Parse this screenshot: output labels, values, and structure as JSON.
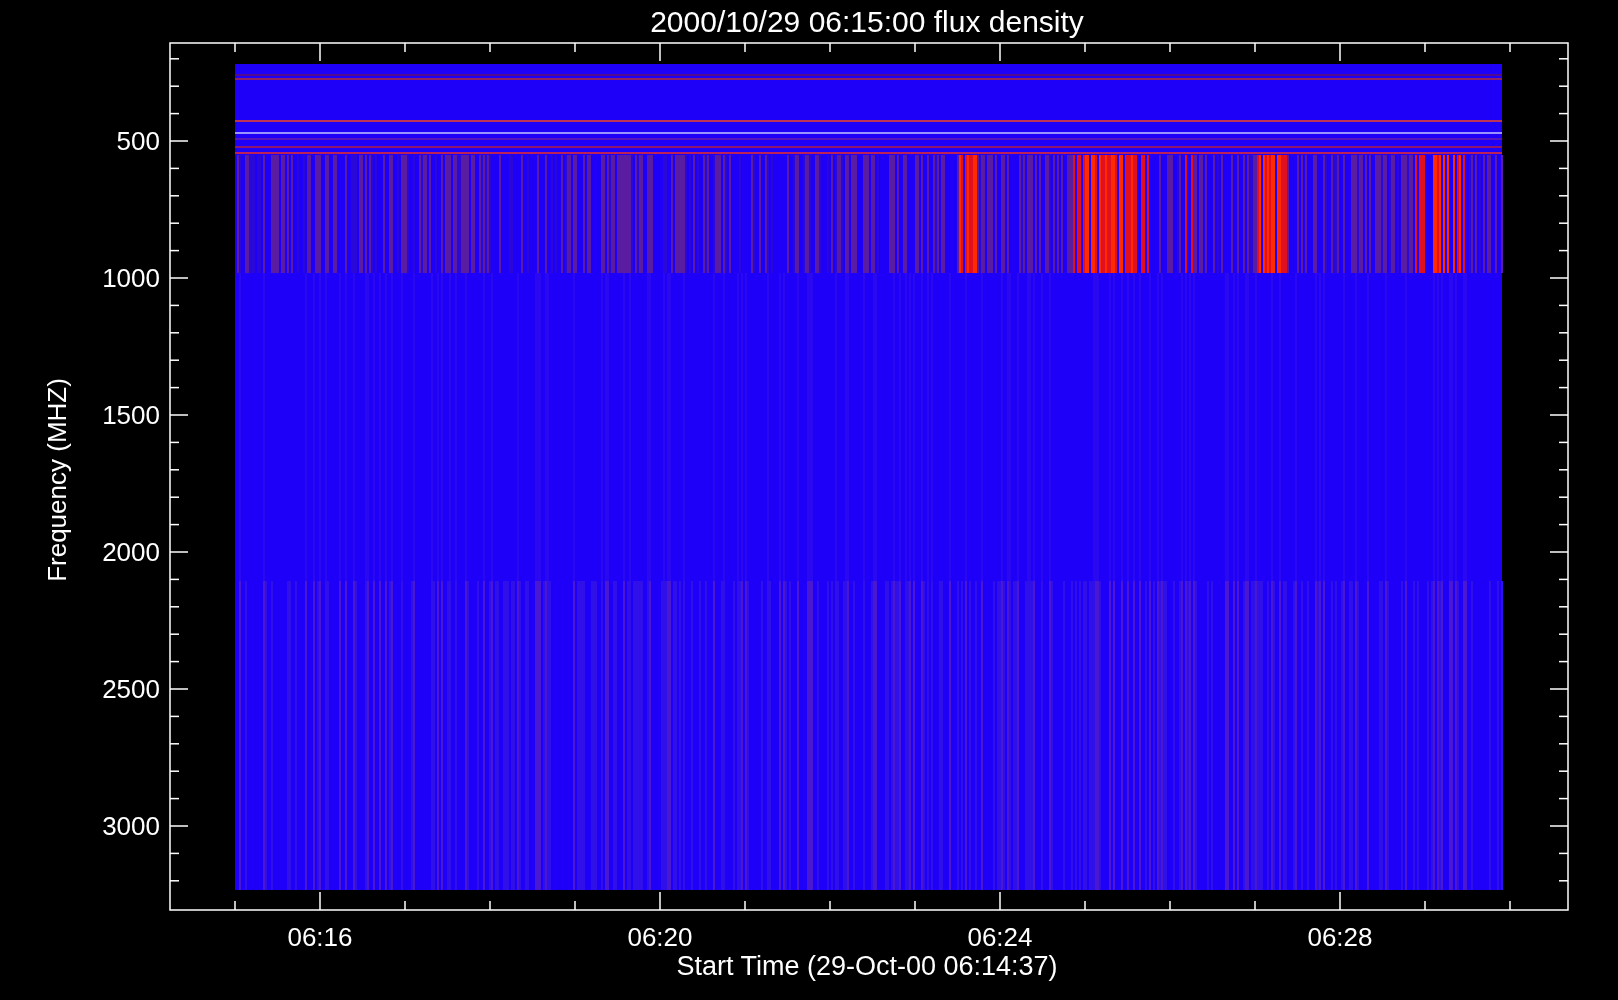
{
  "title": "2000/10/29 06:15:00 flux density",
  "xlabel": "Start Time (29-Oct-00 06:14:37)",
  "ylabel": "Frequency (MHZ)",
  "xticks": [
    "06:16",
    "06:20",
    "06:24",
    "06:28"
  ],
  "yticks": [
    "500",
    "1000",
    "1500",
    "2000",
    "2500",
    "3000"
  ]
}
